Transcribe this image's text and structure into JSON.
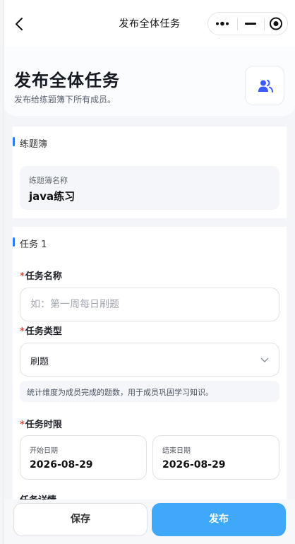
{
  "nav": {
    "title": "发布全体任务"
  },
  "header": {
    "title": "发布全体任务",
    "subtitle": "发布给练题簿下所有成员。"
  },
  "book_section": {
    "title": "练题簿",
    "name_label": "练题簿名称",
    "name_value": "java练习"
  },
  "task_section": {
    "title": "任务 1",
    "name_label": "任务名称",
    "name_placeholder": "如：第一周每日刷题",
    "name_value": "",
    "type_label": "任务类型",
    "type_value": "刷题",
    "type_hint": "统计维度为成员完成的题数，用于成员巩固学习知识。",
    "deadline_label": "任务时限",
    "start_label": "开始日期",
    "start_value": "2026-08-29",
    "end_label": "结束日期",
    "end_value": "2026-08-29",
    "detail_label": "任务详情",
    "required_mark": "*"
  },
  "footer": {
    "save_label": "保存",
    "publish_label": "发布"
  },
  "colors": {
    "accent": "#3fa8f8",
    "section_bar": "#2f7cf6",
    "required": "#e5483a",
    "member_icon": "#3d5afe"
  }
}
